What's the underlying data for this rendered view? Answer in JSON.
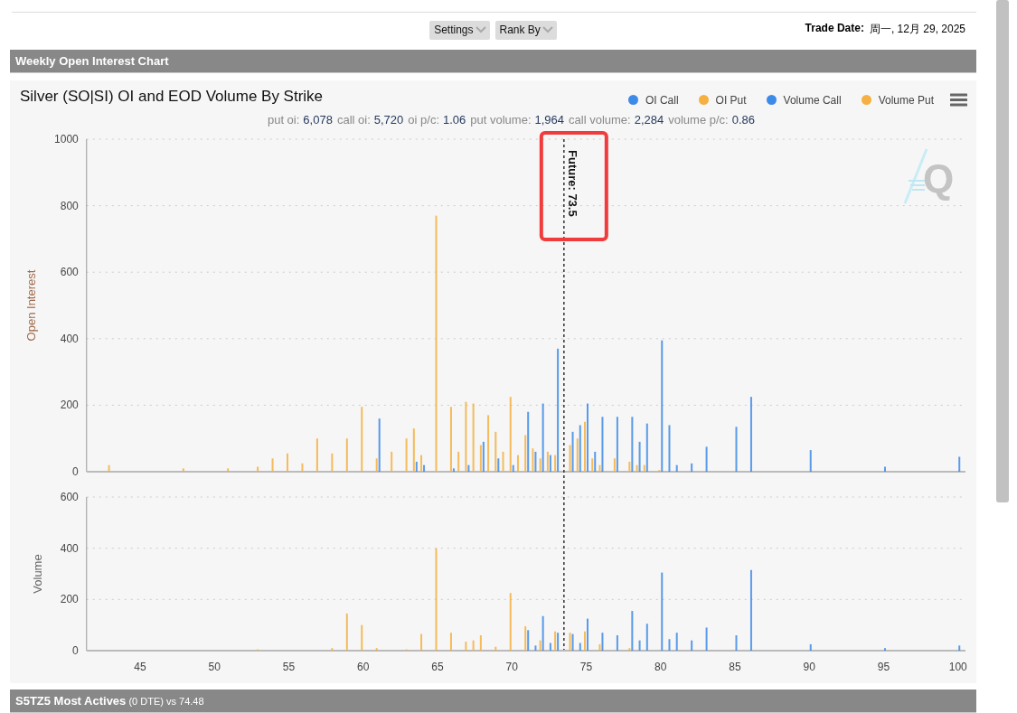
{
  "toolbar": {
    "buttons": [
      {
        "label": "Settings"
      },
      {
        "label": "Rank By"
      }
    ],
    "trade_date": {
      "label": "Trade Date:",
      "value": "周一, 12月 29, 2025"
    }
  },
  "section": {
    "title": "Weekly Open Interest Chart"
  },
  "chart": {
    "title": "Silver (SO|SI) OI and EOD Volume By Strike",
    "highlight_box": true,
    "logo_text": "Q",
    "stats": [
      {
        "label": "put oi:",
        "value": "6,078"
      },
      {
        "label": "call oi:",
        "value": "5,720"
      },
      {
        "label": "oi p/c:",
        "value": "1.06"
      },
      {
        "label": "put volume:",
        "value": "1,964"
      },
      {
        "label": "call volume:",
        "value": "2,284"
      },
      {
        "label": "volume p/c:",
        "value": "0.86"
      }
    ],
    "panes": [
      {
        "chart_data": {
          "type": "bar",
          "grid": true,
          "ylabel": "Open Interest",
          "xlim": [
            41.4,
            100.5
          ],
          "ylim": [
            0,
            1000
          ],
          "yticks": [
            0,
            200,
            400,
            600,
            800,
            1000
          ],
          "x": [
            43,
            48,
            51,
            53,
            54,
            55,
            56,
            57,
            58,
            59,
            60,
            61,
            62,
            63,
            63.5,
            64,
            65,
            66,
            66.5,
            67,
            67.5,
            68,
            68.5,
            69,
            69.5,
            70,
            70.5,
            71,
            71.5,
            72,
            72.5,
            73,
            74,
            74.5,
            75,
            75.5,
            76,
            77,
            78,
            78.5,
            79,
            80,
            80.5,
            81,
            82,
            83,
            85,
            86,
            90,
            95,
            100
          ],
          "series": [
            {
              "name": "OI Call",
              "color": "#3d8be8",
              "values": [
                null,
                null,
                null,
                null,
                null,
                null,
                null,
                null,
                null,
                null,
                null,
                160,
                null,
                null,
                30,
                20,
                null,
                10,
                null,
                20,
                null,
                90,
                null,
                40,
                null,
                20,
                null,
                180,
                60,
                205,
                50,
                370,
                120,
                140,
                205,
                60,
                165,
                165,
                165,
                90,
                145,
                395,
                140,
                20,
                25,
                75,
                135,
                225,
                65,
                15,
                45
              ]
            },
            {
              "name": "OI Put",
              "color": "#f5b041",
              "values": [
                20,
                10,
                10,
                15,
                40,
                55,
                25,
                100,
                55,
                100,
                195,
                40,
                60,
                100,
                130,
                50,
                770,
                195,
                60,
                210,
                205,
                80,
                170,
                120,
                60,
                225,
                50,
                110,
                70,
                40,
                60,
                50,
                80,
                100,
                150,
                40,
                20,
                40,
                30,
                20,
                20,
                5,
                null,
                null,
                null,
                null,
                null,
                null,
                null,
                null,
                null
              ]
            }
          ],
          "ref_lines": [
            {
              "axis": "x",
              "value": 73.5,
              "label": "Future: 73.5",
              "color": "#333333"
            }
          ]
        }
      },
      {
        "chart_data": {
          "type": "bar",
          "grid": true,
          "ylabel": "Volume",
          "xlim": [
            41.4,
            100.5
          ],
          "ylim": [
            0,
            600
          ],
          "yticks": [
            0,
            200,
            400,
            600
          ],
          "xticks": [
            45,
            50,
            55,
            60,
            65,
            70,
            75,
            80,
            85,
            90,
            95,
            100
          ],
          "x": [
            53,
            58,
            59,
            60,
            61,
            63,
            64,
            65,
            66,
            67,
            67.5,
            68,
            69,
            70,
            71,
            71.5,
            72,
            72.5,
            73,
            74,
            74.5,
            75,
            76,
            77,
            78,
            78.5,
            79,
            80,
            80.5,
            81,
            82,
            83,
            85,
            86,
            90,
            95,
            100
          ],
          "series": [
            {
              "name": "Volume Call",
              "color": "#3d8be8",
              "values": [
                null,
                null,
                null,
                null,
                null,
                null,
                null,
                null,
                null,
                null,
                null,
                null,
                null,
                null,
                80,
                20,
                135,
                30,
                70,
                65,
                30,
                125,
                70,
                60,
                155,
                40,
                105,
                305,
                45,
                70,
                40,
                90,
                60,
                315,
                25,
                10,
                20
              ]
            },
            {
              "name": "Volume Put",
              "color": "#f5b041",
              "values": [
                5,
                10,
                145,
                100,
                10,
                5,
                65,
                400,
                70,
                35,
                40,
                60,
                15,
                225,
                95,
                null,
                40,
                null,
                75,
                70,
                null,
                75,
                25,
                null,
                10,
                null,
                null,
                null,
                null,
                null,
                null,
                null,
                null,
                null,
                null,
                null,
                null
              ]
            }
          ]
        }
      }
    ]
  },
  "next_section": {
    "title": "**S5TZ5 Most Actives** (0 DTE) vs 74.48"
  }
}
